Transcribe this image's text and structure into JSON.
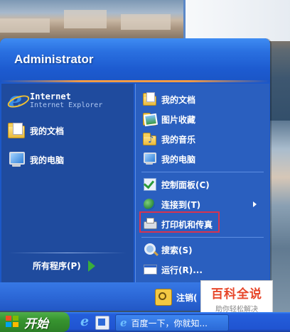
{
  "user": {
    "name": "Administrator"
  },
  "left_pane": {
    "pinned": [
      {
        "label": "Internet",
        "sublabel": "Internet Explorer",
        "icon": "internet-explorer-icon"
      },
      {
        "label": "我的文档",
        "icon": "my-documents-icon"
      },
      {
        "label": "我的电脑",
        "icon": "my-computer-icon"
      }
    ],
    "all_programs": "所有程序(P)"
  },
  "right_pane": {
    "items": [
      {
        "label": "我的文档",
        "icon": "my-documents-icon"
      },
      {
        "label": "图片收藏",
        "icon": "my-pictures-icon"
      },
      {
        "label": "我的音乐",
        "icon": "my-music-icon"
      },
      {
        "label": "我的电脑",
        "icon": "my-computer-icon"
      },
      {
        "label": "控制面板(C)",
        "icon": "control-panel-icon"
      },
      {
        "label": "连接到(T)",
        "icon": "connect-to-icon",
        "has_submenu": true
      },
      {
        "label": "打印机和传真",
        "icon": "printer-icon",
        "highlighted": true
      },
      {
        "label": "搜索(S)",
        "icon": "search-icon"
      },
      {
        "label": "运行(R)...",
        "icon": "run-icon"
      }
    ]
  },
  "footer": {
    "logoff": "注销("
  },
  "watermark": {
    "title": "百科全说",
    "subtitle": "助你轻松解决"
  },
  "taskbar": {
    "start_label": "开始",
    "task_label": "百度一下，你就知..."
  },
  "colors": {
    "menu_blue": "#1c58c9",
    "left_pane": "#1f4b9e",
    "right_pane": "#2a5fbf",
    "start_green": "#37942f",
    "highlight_red": "#d8334f"
  }
}
